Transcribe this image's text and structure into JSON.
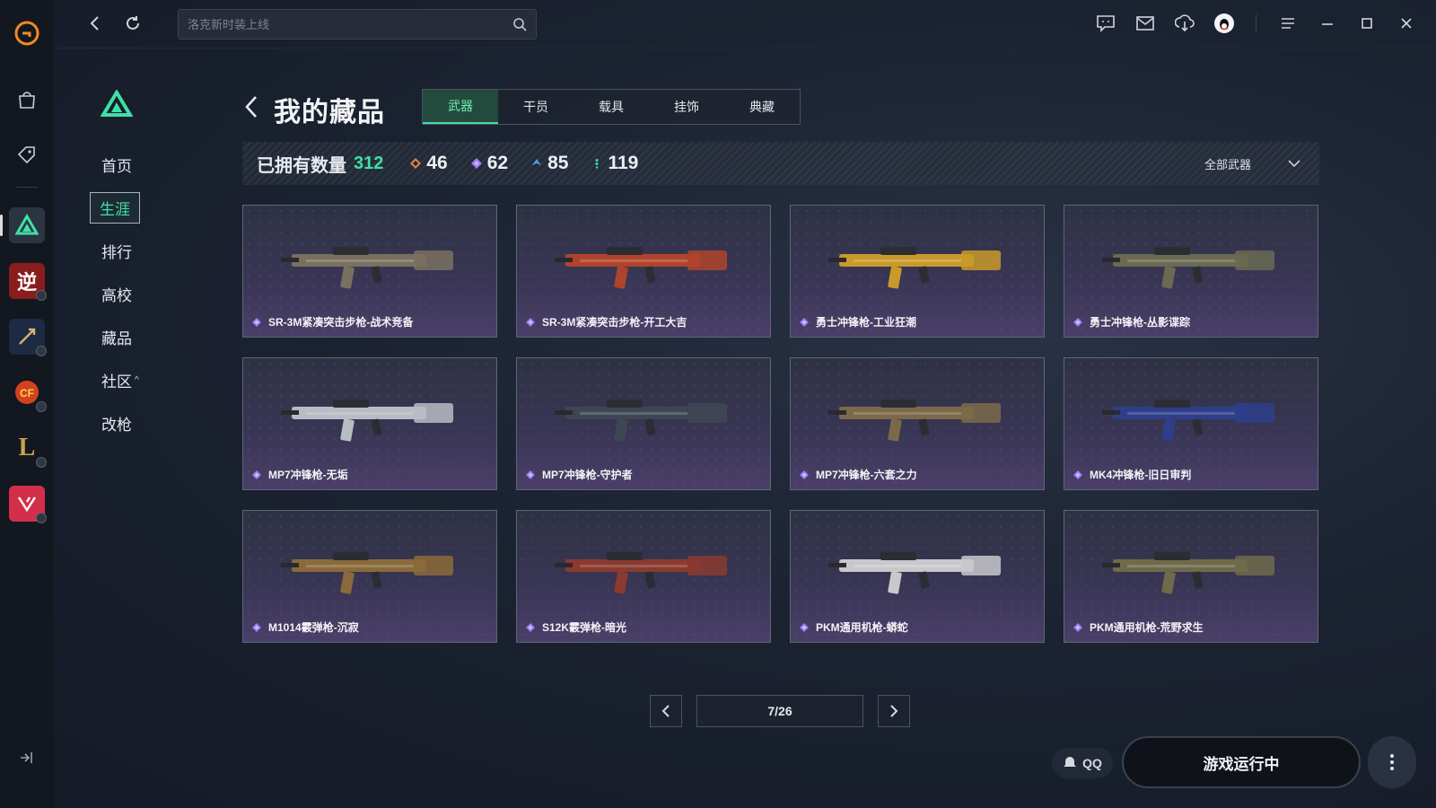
{
  "app": {
    "accent": "#3fe0a5",
    "rail": {
      "top_icons": [
        "logo-icon",
        "bag-icon",
        "tag-icon"
      ],
      "games": [
        "triangle-game-icon",
        "ni-game-icon",
        "sword-game-icon",
        "cf-game-icon",
        "lol-game-icon",
        "valorant-game-icon"
      ]
    }
  },
  "topbar": {
    "search_placeholder": "洛克新时装上线"
  },
  "subnav": {
    "items": [
      {
        "label": "首页"
      },
      {
        "label": "生涯"
      },
      {
        "label": "排行"
      },
      {
        "label": "高校"
      },
      {
        "label": "藏品"
      },
      {
        "label": "社区",
        "caret": "^"
      },
      {
        "label": "改枪"
      }
    ]
  },
  "header": {
    "title": "我的藏品",
    "tabs": [
      "武器",
      "干员",
      "载具",
      "挂饰",
      "典藏"
    ]
  },
  "stats": {
    "owned_label": "已拥有数量",
    "owned_count": "312",
    "tiers": [
      {
        "color": "#e0823a",
        "count": "46"
      },
      {
        "color": "#9c7cf0",
        "count": "62"
      },
      {
        "color": "#4a9ce8",
        "count": "85"
      },
      {
        "color": "#3fe0a5",
        "count": "119"
      }
    ],
    "filter_label": "全部武器"
  },
  "items": [
    {
      "name": "SR-3M紧凑突击步枪-战术竞备",
      "color": "#7a7060"
    },
    {
      "name": "SR-3M紧凑突击步枪-开工大吉",
      "color": "#b0442a"
    },
    {
      "name": "勇士冲锋枪-工业狂潮",
      "color": "#c99a2a"
    },
    {
      "name": "勇士冲锋枪-丛影谍踪",
      "color": "#6a6a52"
    },
    {
      "name": "MP7冲锋枪-无垢",
      "color": "#b8bcc4"
    },
    {
      "name": "MP7冲锋枪-守护者",
      "color": "#3e4654"
    },
    {
      "name": "MP7冲锋枪-六套之力",
      "color": "#7a6a4a"
    },
    {
      "name": "MK4冲锋枪-旧日审判",
      "color": "#2e3e8a"
    },
    {
      "name": "M1014霰弹枪-沉寂",
      "color": "#8a6a3a"
    },
    {
      "name": "S12K霰弹枪-暗光",
      "color": "#8a3a2e"
    },
    {
      "name": "PKM通用机枪-蟒蛇",
      "color": "#c8c8cc"
    },
    {
      "name": "PKM通用机枪-荒野求生",
      "color": "#6e6a4a"
    }
  ],
  "pager": {
    "label": "7/26"
  },
  "footer": {
    "qq_label": "QQ",
    "launch_label": "游戏运行中"
  }
}
